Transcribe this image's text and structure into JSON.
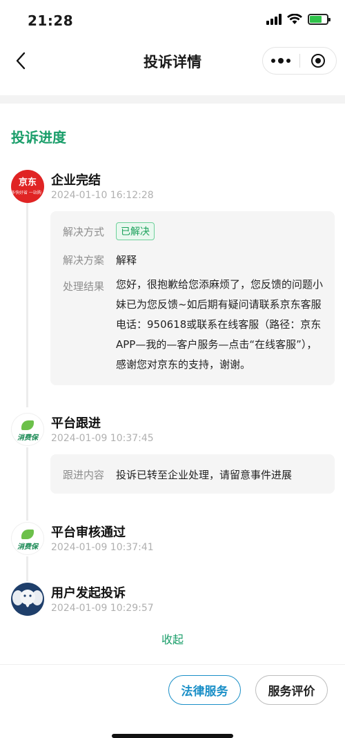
{
  "status_bar": {
    "time": "21:28"
  },
  "nav": {
    "title": "投诉详情"
  },
  "section": {
    "title": "投诉进度"
  },
  "timeline": [
    {
      "title": "企业完结",
      "time": "2024-01-10 16:12:28",
      "avatar": {
        "logo_text": "京东",
        "sub_text": "多快好省 一站购齐"
      },
      "details": {
        "method_label": "解决方式",
        "method_value": "已解决",
        "plan_label": "解决方案",
        "plan_value": "解释",
        "result_label": "处理结果",
        "result_value": "您好，很抱歉给您添麻烦了，您反馈的问题小妹已为您反馈~如后期有疑问请联系京东客服电话：950618或联系在线客服（路径：京东APP—我的—客户服务—点击“在线客服”），感谢您对京东的支持，谢谢。"
      }
    },
    {
      "title": "平台跟进",
      "time": "2024-01-09 10:37:45",
      "avatar": {
        "logo_text": "消费保"
      },
      "details": {
        "content_label": "跟进内容",
        "content_value": "投诉已转至企业处理，请留意事件进展"
      }
    },
    {
      "title": "平台审核通过",
      "time": "2024-01-09 10:37:41",
      "avatar": {
        "logo_text": "消费保"
      }
    },
    {
      "title": "用户发起投诉",
      "time": "2024-01-09 10:29:57",
      "avatar": {
        "icon": "elephant-icon"
      }
    }
  ],
  "collapse_label": "收起",
  "buttons": {
    "legal": "法律服务",
    "rate": "服务评价"
  },
  "colors": {
    "accent_green": "#1a9e6a",
    "legal_blue": "#1a8fc7",
    "jd_red": "#e02424"
  }
}
